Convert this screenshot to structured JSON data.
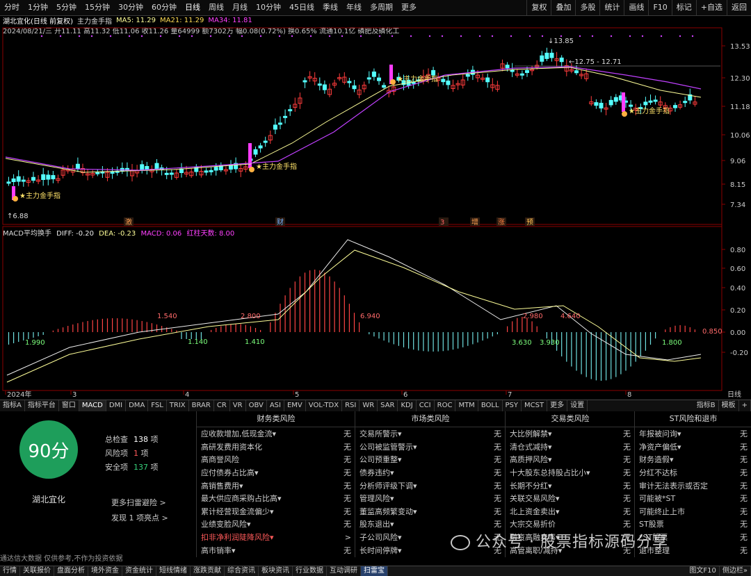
{
  "topbar": {
    "periods": [
      "分时",
      "1分钟",
      "5分钟",
      "15分钟",
      "30分钟",
      "60分钟",
      "日线",
      "周线",
      "月线",
      "10分钟",
      "45日线",
      "季线",
      "年线",
      "多周期",
      "更多"
    ],
    "active_period": "日线",
    "right_items": [
      "复权",
      "叠加",
      "多股",
      "统计",
      "画线",
      "F10",
      "标记",
      "+自选",
      "返回"
    ]
  },
  "info": {
    "stock_title": "湖北宜化(日线 前复权)",
    "indicator": "主力金手指",
    "ma5": "MA5: 11.29",
    "ma21": "MA21: 11.29",
    "ma34": "MA34: 11.81",
    "quote_line": "2024/08/21/三 开11.11 高11.32 低11.06 收11.26 量64999 额7302万 幅0.08(0.72%) 换0.65% 流通10.1亿 磷肥及磷化工"
  },
  "colors": {
    "up": "#ff3c3c",
    "down": "#54ffff",
    "signal": "#ff3cff",
    "ma_fast": "#ffff99",
    "ma_slow": "#c040ff",
    "green": "#1e9e5b"
  },
  "main_chart": {
    "price_levels": [
      "13.53",
      "12.30",
      "11.18",
      "10.06",
      "9.06",
      "8.15",
      "7.34"
    ],
    "high_label": "13.85",
    "low_label": "6.88",
    "range_label": "12.75 - 12.71",
    "signal_label": "主力金手指",
    "event_tags": [
      "激",
      "财",
      "3",
      "增",
      "涨",
      "预"
    ]
  },
  "macd": {
    "header": "MACD平均换手",
    "diff": "DIFF: -0.20",
    "dea": "DEA: -0.23",
    "macd": "MACD: 0.06",
    "red_days": "红柱天数: 8.00",
    "levels": [
      "0.80",
      "0.60",
      "0.40",
      "0.20",
      "0.00",
      "-0.20"
    ],
    "bar_labels": [
      "1.990",
      "1.540",
      "1.140",
      "1.410",
      "2.800",
      "6.940",
      "3.630",
      "3.930",
      "2.980",
      "4.640",
      "1.800",
      "0.850"
    ]
  },
  "time_axis": {
    "labels": [
      "2024年",
      "3",
      "4",
      "5",
      "6",
      "7",
      "8"
    ],
    "right": "日线"
  },
  "indicator_tabs": [
    "指标A",
    "指标平台",
    "窗口",
    "MACD",
    "DMI",
    "DMA",
    "FSL",
    "TRIX",
    "BRAR",
    "CR",
    "VR",
    "OBV",
    "ASI",
    "EMV",
    "VOL-TDX",
    "RSI",
    "WR",
    "SAR",
    "KDJ",
    "CCI",
    "ROC",
    "MTM",
    "BOLL",
    "PSY",
    "MCST",
    "更多",
    "设置"
  ],
  "indicator_tabs_right": [
    "指标B",
    "模板",
    "+"
  ],
  "scan": {
    "score": "90分",
    "stock_name": "湖北宜化",
    "total_label": "总检查",
    "total_value": "138",
    "total_unit": "项",
    "risk_label": "风险项",
    "risk_value": "1",
    "risk_unit": "项",
    "safe_label": "安全项",
    "safe_value": "137",
    "safe_unit": "项",
    "more_link": "更多扫雷避险 >",
    "found_link": "发现 1 项亮点 >",
    "columns": [
      {
        "title": "财务类风险",
        "rows": [
          {
            "label": "应收款增加,低现金流▾",
            "value": "无"
          },
          {
            "label": "高研发费用资本化",
            "value": "无"
          },
          {
            "label": "高商誉风险",
            "value": "无"
          },
          {
            "label": "应付债券占比高▾",
            "value": "无"
          },
          {
            "label": "高销售费用▾",
            "value": "无"
          },
          {
            "label": "最大供应商采购占比高▾",
            "value": "无"
          },
          {
            "label": "累计经营现金流偏少▾",
            "value": "无"
          },
          {
            "label": "业绩变脸风险▾",
            "value": "无"
          },
          {
            "label": "扣非净利润陡降风险▾",
            "value": ">",
            "warn": true
          },
          {
            "label": "高市销率▾",
            "value": "无"
          }
        ]
      },
      {
        "title": "市场类风险",
        "rows": [
          {
            "label": "交易所警示▾",
            "value": "无"
          },
          {
            "label": "公司被监管警示▾",
            "value": "无"
          },
          {
            "label": "公司预重整▾",
            "value": "无"
          },
          {
            "label": "债券违约▾",
            "value": "无"
          },
          {
            "label": "分析师评级下调▾",
            "value": "无"
          },
          {
            "label": "管理风险▾",
            "value": "无"
          },
          {
            "label": "董监高频繁变动▾",
            "value": "无"
          },
          {
            "label": "股东退出▾",
            "value": "无"
          },
          {
            "label": "子公司风险▾",
            "value": "无"
          },
          {
            "label": "长时间停牌▾",
            "value": "无"
          }
        ]
      },
      {
        "title": "交易类风险",
        "rows": [
          {
            "label": "大比例解禁▾",
            "value": "无"
          },
          {
            "label": "清仓式减持▾",
            "value": "无"
          },
          {
            "label": "高质押风险▾",
            "value": "无"
          },
          {
            "label": "十大股东总持股占比小▾",
            "value": "无"
          },
          {
            "label": "长期不分红▾",
            "value": "无"
          },
          {
            "label": "关联交易风险▾",
            "value": "无"
          },
          {
            "label": "北上资金卖出▾",
            "value": "无"
          },
          {
            "label": "大宗交易折价",
            "value": "无"
          },
          {
            "label": "融资高融卖率▾",
            "value": "无"
          },
          {
            "label": "高管离职/减持▾",
            "value": "无"
          }
        ]
      },
      {
        "title": "ST风险和退市",
        "rows": [
          {
            "label": "年报被问询▾",
            "value": "无"
          },
          {
            "label": "净资产偏低▾",
            "value": "无"
          },
          {
            "label": "财务造假▾",
            "value": "无"
          },
          {
            "label": "分红不达标",
            "value": "无"
          },
          {
            "label": "审计无法表示或否定",
            "value": "无"
          },
          {
            "label": "可能被*ST",
            "value": "无"
          },
          {
            "label": "可能终止上市",
            "value": "无"
          },
          {
            "label": "ST股票",
            "value": "无"
          },
          {
            "label": "*ST股票",
            "value": "无"
          },
          {
            "label": "退市整理",
            "value": "无"
          }
        ]
      }
    ]
  },
  "disclaimer": "通达信大数据 仅供参考,不作为投资依据",
  "bottombar": {
    "items": [
      "行情",
      "关联报价",
      "盘面分析",
      "境外资金",
      "资金统计",
      "短线情绪",
      "涨跌贡献",
      "综合资讯",
      "板块资讯",
      "行业数据",
      "互动调研",
      "扫雷宝"
    ],
    "active": "扫雷宝",
    "right": [
      "图文F10",
      "侧边栏»"
    ]
  },
  "watermark": "公众号 · 股票指标源码分享"
}
